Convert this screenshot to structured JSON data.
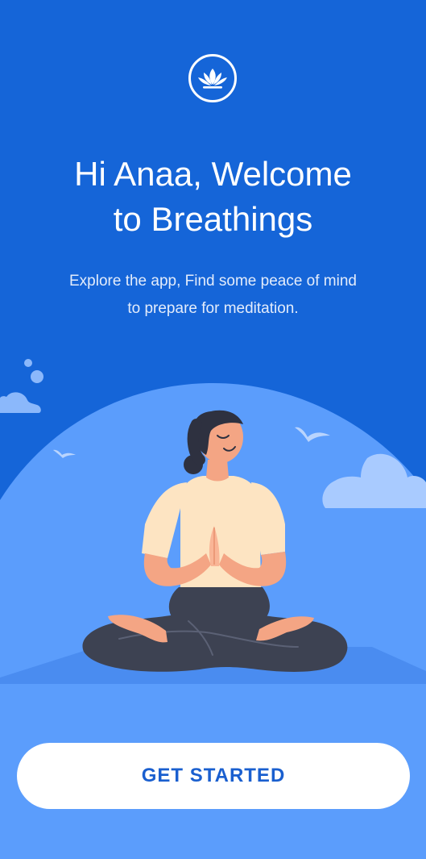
{
  "welcome": {
    "logo_icon": "lotus-icon",
    "title_line1": "Hi Anaa, Welcome",
    "title_line2": "to Breathings",
    "subtitle_line1": "Explore the app, Find some peace of mind",
    "subtitle_line2": "to prepare for meditation."
  },
  "illustration": {
    "icon": "meditating-woman-illustration"
  },
  "actions": {
    "get_started_label": "GET STARTED"
  },
  "colors": {
    "background": "#1565d8",
    "hill": "#5b9dfc",
    "mat": "#4a8cf0",
    "cloud": "#a9cbff",
    "button_text": "#1a5fcf"
  }
}
